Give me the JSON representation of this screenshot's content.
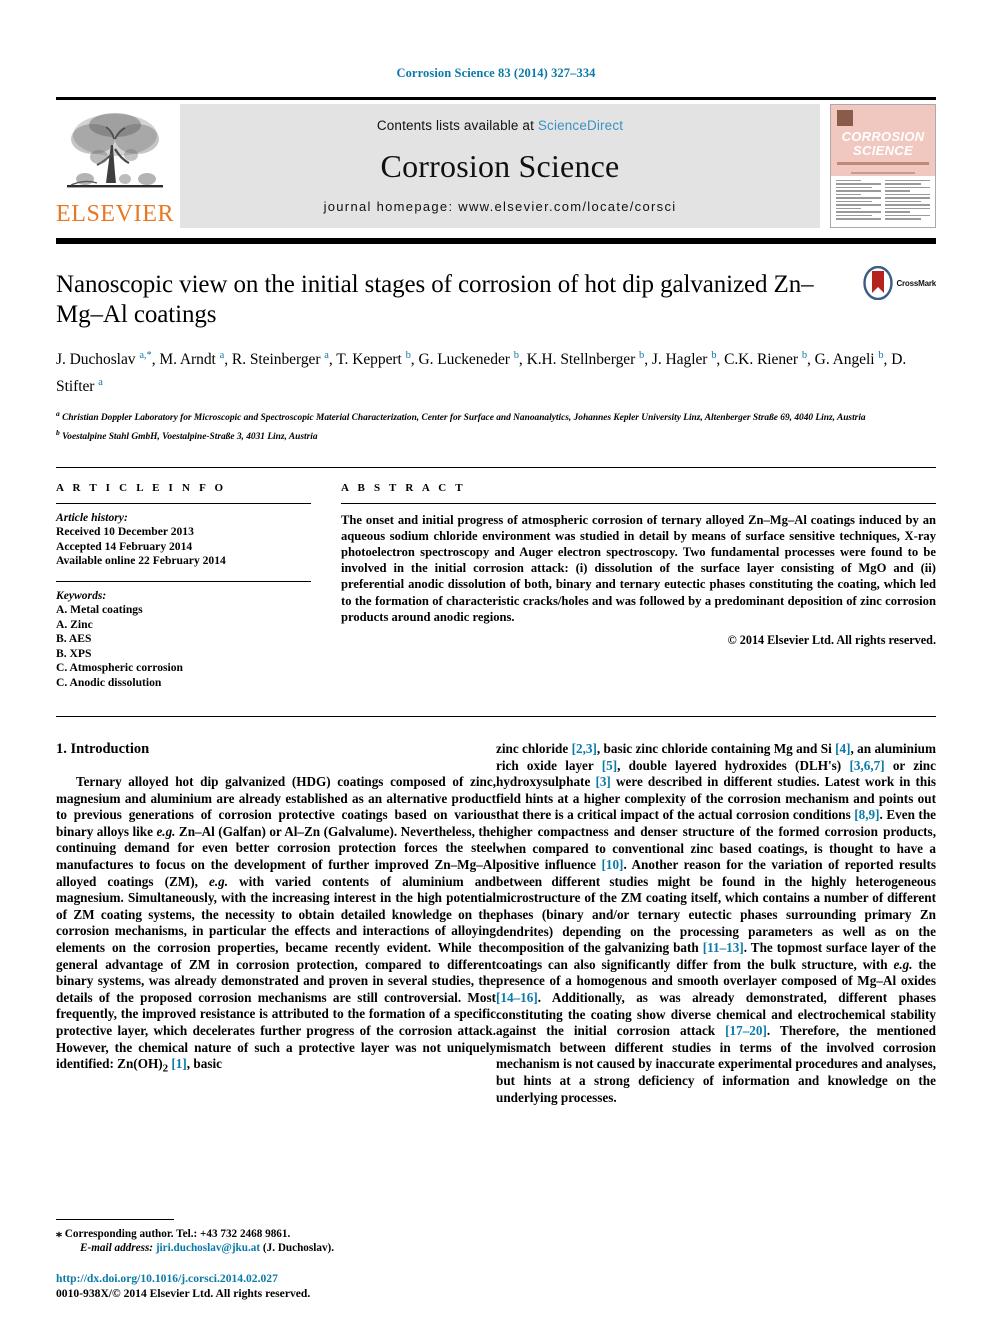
{
  "running_head": "Corrosion Science 83 (2014) 327–334",
  "masthead": {
    "publisher_logo_text": "ELSEVIER",
    "contents_prefix": "Contents lists available at ",
    "contents_link": "ScienceDirect",
    "journal_name": "Corrosion Science",
    "homepage_line": "journal homepage: www.elsevier.com/locate/corsci",
    "cover_title_line1": "CORROSION",
    "cover_title_line2": "SCIENCE"
  },
  "article": {
    "title": "Nanoscopic view on the initial stages of corrosion of hot dip galvanized Zn–Mg–Al coatings",
    "crossmark_label": "CrossMark",
    "authors_line1_pre": "J. Duchoslav ",
    "authors": "J. Duchoslav a,*, M. Arndt a, R. Steinberger a, T. Keppert b, G. Luckeneder b, K.H. Stellnberger b, J. Hagler b, C.K. Riener b, G. Angeli b, D. Stifter a",
    "affiliation_a": "Christian Doppler Laboratory for Microscopic and Spectroscopic Material Characterization, Center for Surface and Nanoanalytics, Johannes Kepler University Linz, Altenberger Straße 69, 4040 Linz, Austria",
    "affiliation_b": "Voestalpine Stahl GmbH, Voestalpine-Straße 3, 4031 Linz, Austria"
  },
  "article_info": {
    "heading": "A R T I C L E   I N F O",
    "history_label": "Article history:",
    "received": "Received 10 December 2013",
    "accepted": "Accepted 14 February 2014",
    "available": "Available online 22 February 2014",
    "keywords_label": "Keywords:",
    "keywords": [
      "A. Metal coatings",
      "A. Zinc",
      "B. AES",
      "B. XPS",
      "C. Atmospheric corrosion",
      "C. Anodic dissolution"
    ]
  },
  "abstract": {
    "heading": "A B S T R A C T",
    "body": "The onset and initial progress of atmospheric corrosion of ternary alloyed Zn–Mg–Al coatings induced by an aqueous sodium chloride environment was studied in detail by means of surface sensitive techniques, X-ray photoelectron spectroscopy and Auger electron spectroscopy. Two fundamental processes were found to be involved in the initial corrosion attack: (i) dissolution of the surface layer consisting of MgO and (ii) preferential anodic dissolution of both, binary and ternary eutectic phases constituting the coating, which led to the formation of characteristic cracks/holes and was followed by a predominant deposition of zinc corrosion products around anodic regions.",
    "copyright": "© 2014 Elsevier Ltd. All rights reserved."
  },
  "intro": {
    "heading": "1. Introduction",
    "left_paragraph": "Ternary alloyed hot dip galvanized (HDG) coatings composed of zinc, magnesium and aluminium are already established as an alternative product to previous generations of corrosion protective coatings based on various binary alloys like e.g. Zn–Al (Galfan) or Al–Zn (Galvalume). Nevertheless, the continuing demand for even better corrosion protection forces the steel manufactures to focus on the development of further improved Zn–Mg–Al alloyed coatings (ZM), e.g. with varied contents of aluminium and magnesium. Simultaneously, with the increasing interest in the high potential of ZM coating systems, the necessity to obtain detailed knowledge on the corrosion mechanisms, in particular the effects and interactions of alloying elements on the corrosion properties, became recently evident. While the general advantage of ZM in corrosion protection, compared to different binary systems, was already demonstrated and proven in several studies, the details of the proposed corrosion mechanisms are still controversial. Most frequently, the improved resistance is attributed to the formation of a specific protective layer, which decelerates further progress of the corrosion attack. However, the chemical nature of such a protective layer was not uniquely identified: Zn(OH)2 [1], basic",
    "right_paragraph": "zinc chloride [2,3], basic zinc chloride containing Mg and Si [4], an aluminium rich oxide layer [5], double layered hydroxides (DLH's) [3,6,7] or zinc hydroxysulphate [3] were described in different studies. Latest work in this field hints at a higher complexity of the corrosion mechanism and points out that there is a critical impact of the actual corrosion conditions [8,9]. Even the higher compactness and denser structure of the formed corrosion products, when compared to conventional zinc based coatings, is thought to have a positive influence [10]. Another reason for the variation of reported results between different studies might be found in the highly heterogeneous microstructure of the ZM coating itself, which contains a number of different phases (binary and/or ternary eutectic phases surrounding primary Zn dendrites) depending on the processing parameters as well as on the composition of the galvanizing bath [11–13]. The topmost surface layer of the coatings can also significantly differ from the bulk structure, with e.g. the presence of a homogenous and smooth overlayer composed of Mg–Al oxides [14–16]. Additionally, as was already demonstrated, different phases constituting the coating show diverse chemical and electrochemical stability against the initial corrosion attack [17–20]. Therefore, the mentioned mismatch between different studies in terms of the involved corrosion mechanism is not caused by inaccurate experimental procedures and analyses, but hints at a strong deficiency of information and knowledge on the underlying processes."
  },
  "footnote": {
    "corresponding": "Corresponding author. Tel.: +43 732 2468 9861.",
    "email_label": "E-mail address:",
    "email": "jiri.duchoslav@jku.at",
    "email_suffix": "(J. Duchoslav).",
    "doi": "http://dx.doi.org/10.1016/j.corsci.2014.02.027",
    "issn_copyright": "0010-938X/© 2014 Elsevier Ltd. All rights reserved."
  },
  "colors": {
    "link": "#0b7aa8",
    "sciencedirect": "#3c92c4",
    "elsevier_orange": "#e87722",
    "masthead_grey": "#e3e3e3",
    "cover_pink": "#f0c8c0"
  }
}
